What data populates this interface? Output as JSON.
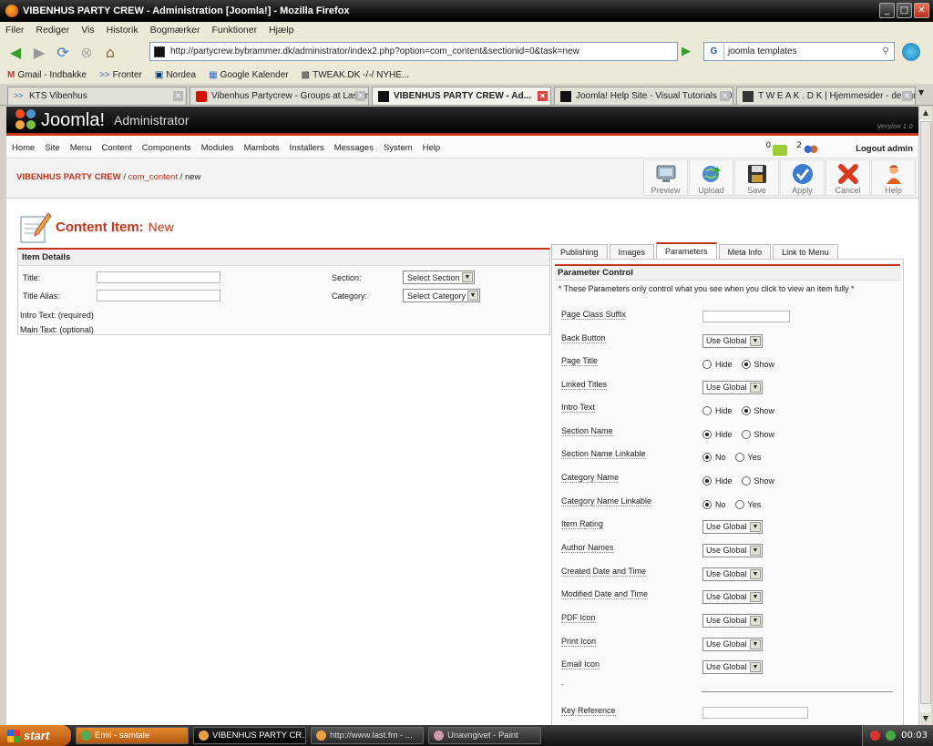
{
  "window": {
    "title": "VIBENHUS PARTY CREW - Administration [Joomla!] - Mozilla Firefox"
  },
  "menubar": [
    "Filer",
    "Rediger",
    "Vis",
    "Historik",
    "Bogmærker",
    "Funktioner",
    "Hjælp"
  ],
  "nav": {
    "url": "http://partycrew.bybrammer.dk/administrator/index2.php?option=com_content&sectionid=0&task=new",
    "search_engine": "G",
    "search_value": "joomla templates"
  },
  "bookmarks": [
    {
      "label": "Gmail - Indbakke",
      "icon": "gmail-icon"
    },
    {
      "label": "Fronter",
      "icon": "fronter-icon"
    },
    {
      "label": "Nordea",
      "icon": "nordea-icon"
    },
    {
      "label": "Google Kalender",
      "icon": "calendar-icon"
    },
    {
      "label": "TWEAK.DK -/-/ NYHE...",
      "icon": "tweak-icon"
    }
  ],
  "tabs": [
    {
      "label": "KTS Vibenhus"
    },
    {
      "label": "Vibenhus Partycrew - Groups at Last.fm"
    },
    {
      "label": "VIBENHUS PARTY CREW - Ad..."
    },
    {
      "label": "Joomla! Help Site - Visual Tutorials 1.0x"
    },
    {
      "label": "T W E A K . D K | Hjemmesider - design..."
    }
  ],
  "joomla": {
    "logo": "Joomla!",
    "admin_label": "Administrator",
    "version": "Version 1.0",
    "menu": [
      "Home",
      "Site",
      "Menu",
      "Content",
      "Components",
      "Modules",
      "Mambots",
      "Installers",
      "Messages",
      "System",
      "Help"
    ],
    "messages_count": "0",
    "users_count": "2",
    "logout": "Logout admin",
    "breadcrumb": {
      "site": "VIBENHUS PARTY CREW",
      "component": "com_content",
      "task": "new"
    },
    "toolbar": [
      "Preview",
      "Upload",
      "Save",
      "Apply",
      "Cancel",
      "Help"
    ],
    "page_title": "Content Item:",
    "page_subtitle": "New"
  },
  "item_details": {
    "header": "Item Details",
    "title_label": "Title:",
    "alias_label": "Title Alias:",
    "section_label": "Section:",
    "section_value": "Select Section",
    "category_label": "Category:",
    "category_value": "Select Category",
    "intro_label": "Intro Text: (required)",
    "main_label": "Main Text: (optional)"
  },
  "param_tabs": [
    "Publishing",
    "Images",
    "Parameters",
    "Meta Info",
    "Link to Menu"
  ],
  "params": {
    "header": "Parameter Control",
    "note": "* These Parameters only control what you see when you click to view an item fully *",
    "rows": [
      {
        "label": "Page Class Suffix",
        "type": "text",
        "value": ""
      },
      {
        "label": "Back Button",
        "type": "select",
        "value": "Use Global"
      },
      {
        "label": "Page Title",
        "type": "radio",
        "options": [
          "Hide",
          "Show"
        ],
        "selected": 1
      },
      {
        "label": "Linked Titles",
        "type": "select",
        "value": "Use Global"
      },
      {
        "label": "Intro Text",
        "type": "radio",
        "options": [
          "Hide",
          "Show"
        ],
        "selected": 1
      },
      {
        "label": "Section Name",
        "type": "radio",
        "options": [
          "Hide",
          "Show"
        ],
        "selected": 0
      },
      {
        "label": "Section Name Linkable",
        "type": "radio",
        "options": [
          "No",
          "Yes"
        ],
        "selected": 0
      },
      {
        "label": "Category Name",
        "type": "radio",
        "options": [
          "Hide",
          "Show"
        ],
        "selected": 0
      },
      {
        "label": "Category Name Linkable",
        "type": "radio",
        "options": [
          "No",
          "Yes"
        ],
        "selected": 0
      },
      {
        "label": "Item Rating",
        "type": "select",
        "value": "Use Global"
      },
      {
        "label": "Author Names",
        "type": "select",
        "value": "Use Global"
      },
      {
        "label": "Created Date and Time",
        "type": "select",
        "value": "Use Global"
      },
      {
        "label": "Modified Date and Time",
        "type": "select",
        "value": "Use Global"
      },
      {
        "label": "PDF Icon",
        "type": "select",
        "value": "Use Global"
      },
      {
        "label": "Print Icon",
        "type": "select",
        "value": "Use Global"
      },
      {
        "label": "Email Icon",
        "type": "select",
        "value": "Use Global"
      },
      {
        "label": "-",
        "type": "divider"
      },
      {
        "label": "Key Reference",
        "type": "text",
        "value": ""
      }
    ]
  },
  "taskbar": {
    "start": "start",
    "tasks": [
      "Emil - samtale",
      "VIBENHUS PARTY CR...",
      "http://www.last.fm - ...",
      "Unavngivet - Paint"
    ],
    "clock": "00:03"
  },
  "colors": {
    "joomla_red": "#c4331b",
    "header_black": "#000000"
  }
}
